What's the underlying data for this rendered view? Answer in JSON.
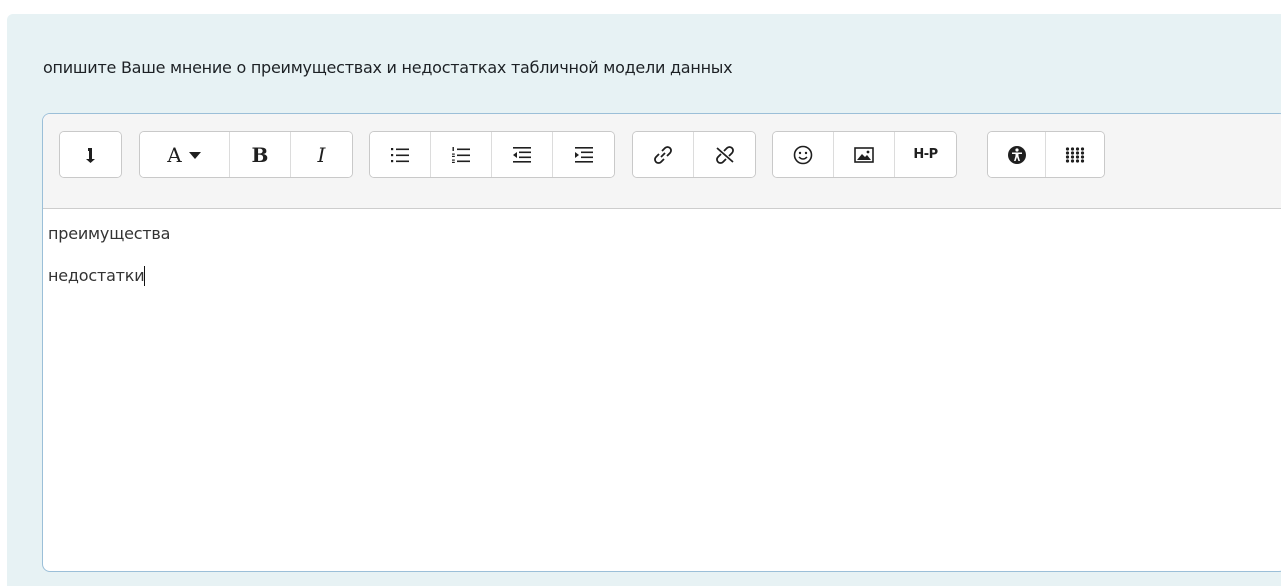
{
  "question": {
    "text": "опишите Ваше мнение о преимуществах и недостатках табличной модели данных"
  },
  "editor": {
    "toolbar": {
      "groups": [
        {
          "buttons": [
            {
              "icon": "collapse-toolbar-icon"
            }
          ]
        },
        {
          "buttons": [
            {
              "icon": "text-style-dropdown-icon",
              "label": "A"
            },
            {
              "icon": "bold-icon",
              "label": "B"
            },
            {
              "icon": "italic-icon",
              "label": "I"
            }
          ]
        },
        {
          "buttons": [
            {
              "icon": "unordered-list-icon"
            },
            {
              "icon": "ordered-list-icon"
            },
            {
              "icon": "outdent-icon"
            },
            {
              "icon": "indent-icon"
            }
          ]
        },
        {
          "buttons": [
            {
              "icon": "link-icon"
            },
            {
              "icon": "unlink-icon"
            }
          ]
        },
        {
          "buttons": [
            {
              "icon": "emoji-icon"
            },
            {
              "icon": "image-icon"
            },
            {
              "icon": "h5p-icon",
              "label": "H-P"
            }
          ]
        },
        {
          "buttons": [
            {
              "icon": "accessibility-checker-icon"
            },
            {
              "icon": "equation-editor-icon"
            }
          ]
        }
      ]
    },
    "content": {
      "line1": "преимущества",
      "line2": "недостатки"
    }
  },
  "colors": {
    "panel_bg": "#e7f2f4",
    "editor_border": "#9bbfd8",
    "toolbar_bg": "#f5f5f5"
  }
}
